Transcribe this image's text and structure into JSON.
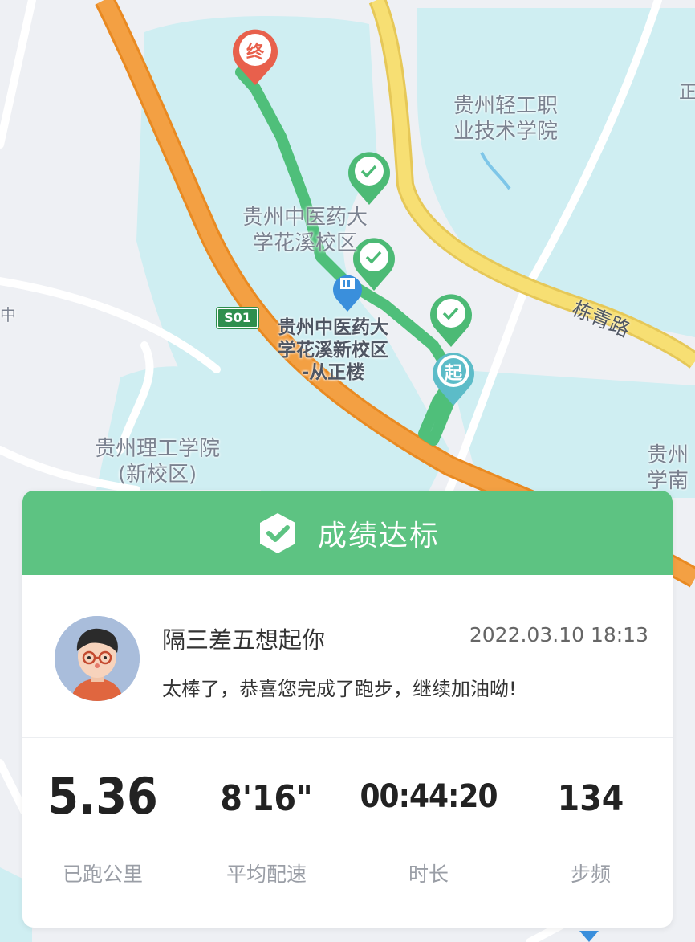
{
  "map": {
    "labels": {
      "college_light": "贵州轻工职\n业技术学院",
      "tcm_campus": "贵州中医药大\n学花溪校区",
      "tcm_new_campus": "贵州中医药大\n学花溪新校区\n-从正楼",
      "tech_university": "贵州理工学院\n(新校区)",
      "edge_right_bottom": "贵州\n学南",
      "edge_left": "中",
      "edge_right_top": "正",
      "road_name": "栋青路",
      "highway_shield": "S01"
    },
    "markers": {
      "end": "终",
      "start": "起"
    },
    "colors": {
      "route": "#4fbf7a",
      "water": "#cfeef2",
      "highway": "#f0992f",
      "road_yellow": "#f7df73",
      "pin_red": "#e8604c",
      "pin_green": "#4cba75",
      "pin_teal": "#5cbcc8"
    }
  },
  "card": {
    "header_title": "成绩达标",
    "user": {
      "name": "隔三差五想起你",
      "time": "2022.03.10 18:13",
      "message": "太棒了，恭喜您完成了跑步，继续加油呦!"
    },
    "stats": [
      {
        "value": "5.36",
        "label": "已跑公里"
      },
      {
        "value": "8'16\"",
        "label": "平均配速"
      },
      {
        "value": "00:44:20",
        "label": "时长"
      },
      {
        "value": "134",
        "label": "步频"
      }
    ],
    "colors": {
      "header_bg": "#5dc382"
    }
  }
}
